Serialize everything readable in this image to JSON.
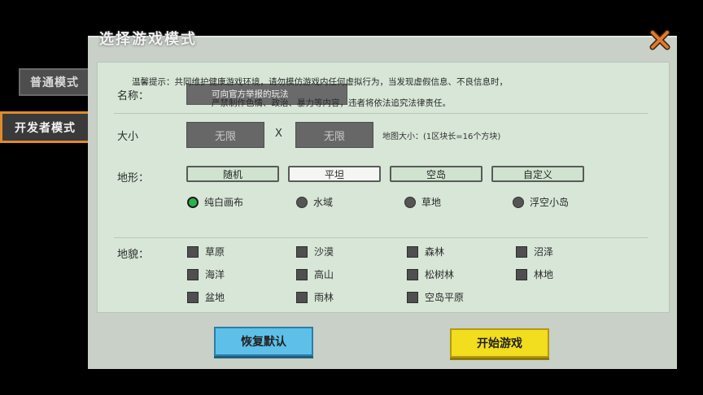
{
  "title": "选择游戏模式",
  "tabs": {
    "normal": "普通模式",
    "developer": "开发者模式"
  },
  "name": {
    "label": "名称：",
    "hint": "可向官方举报的玩法"
  },
  "notice": {
    "line1": "温馨提示：共同维护健康游戏环境，请勿模仿游戏内任何虚拟行为，当发现虚假信息、不良信息时，",
    "line2": "严禁制作色情、政治、暴力等内容，违者将依法追究法律责任。"
  },
  "size": {
    "label": "大小",
    "width": "无限",
    "separator": "X",
    "height": "无限",
    "info": "地图大小：(1区块长=16个方块)"
  },
  "terrain": {
    "label": "地形：",
    "buttons": [
      "随机",
      "平坦",
      "空岛",
      "自定义"
    ],
    "selected": "平坦",
    "options": [
      "纯白画布",
      "水域",
      "草地",
      "浮空小岛"
    ],
    "selected_option": "纯白画布"
  },
  "landform": {
    "label": "地貌：",
    "items": [
      "草原",
      "沙漠",
      "森林",
      "沼泽",
      "海洋",
      "高山",
      "松树林",
      "林地",
      "盆地",
      "雨林",
      "空岛平原"
    ]
  },
  "buttons": {
    "reset": "恢复默认",
    "start": "开始游戏"
  },
  "colors": {
    "reset_button": "#5ec0e8",
    "start_button": "#f2dd1e",
    "selected_radio": "#2bb24c",
    "developer_tab_border": "#e08a2a"
  }
}
